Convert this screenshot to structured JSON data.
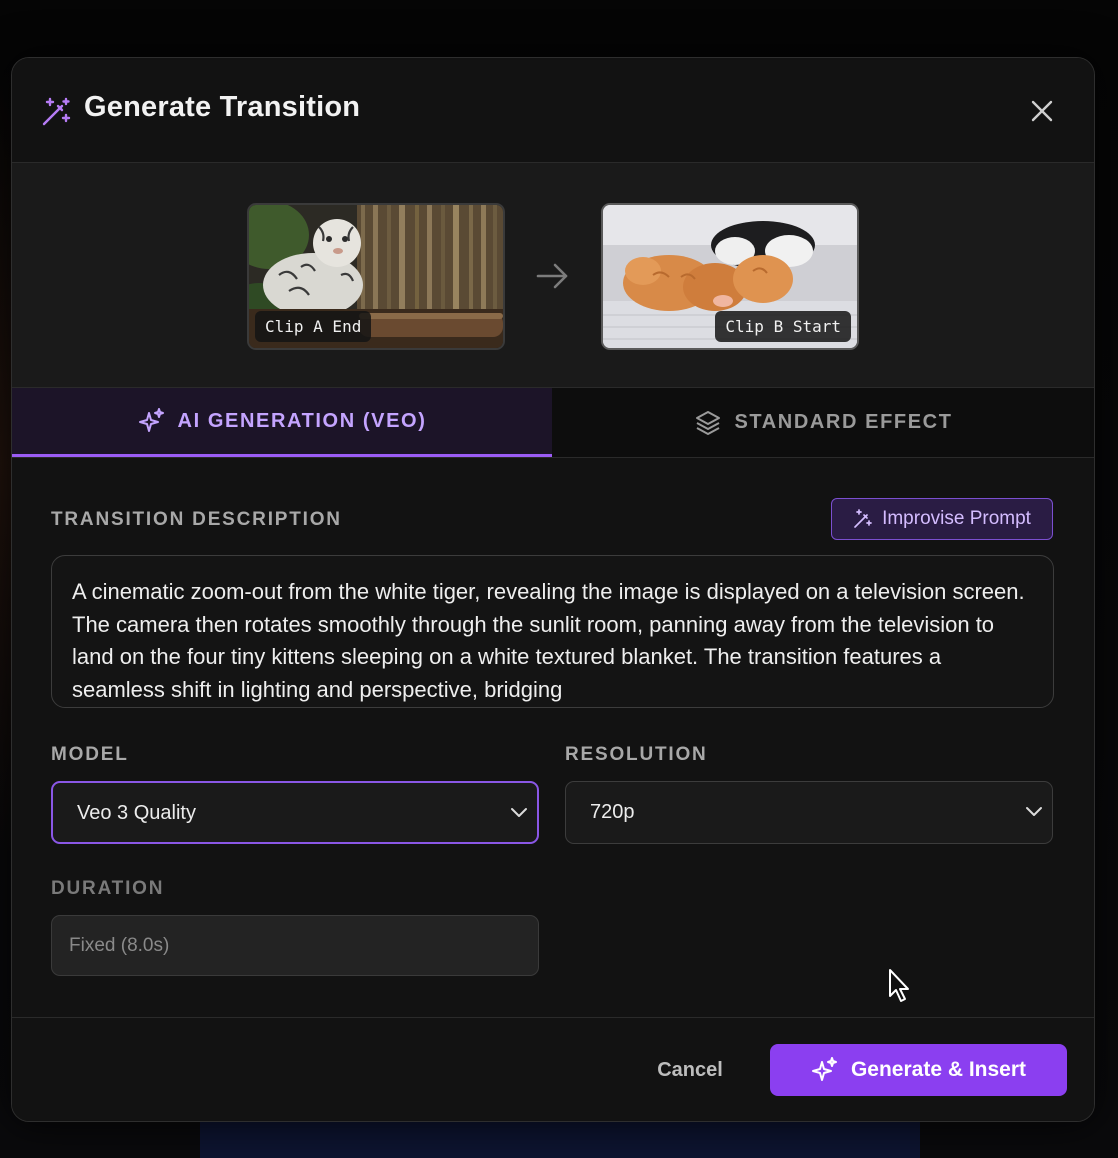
{
  "dialog": {
    "title": "Generate Transition",
    "icon": "magic-wand-icon",
    "close_icon": "close-icon"
  },
  "preview": {
    "clip_a_label": "Clip A End",
    "clip_b_label": "Clip B Start",
    "arrow_icon": "arrow-right-icon"
  },
  "tabs": [
    {
      "label": "AI GENERATION (VEO)",
      "icon": "sparkles-icon",
      "active": true
    },
    {
      "label": "STANDARD EFFECT",
      "icon": "layers-icon",
      "active": false
    }
  ],
  "form": {
    "description_label": "TRANSITION DESCRIPTION",
    "improve_prompt_label": "Improvise Prompt",
    "description_value": "A cinematic zoom-out from the white tiger, revealing the image is displayed on a television screen. The camera then rotates smoothly through the sunlit room, panning away from the television to land on the four tiny kittens sleeping on a white textured blanket. The transition features a seamless shift in lighting and perspective, bridging",
    "model_label": "MODEL",
    "model_value": "Veo 3 Quality",
    "resolution_label": "RESOLUTION",
    "resolution_value": "720p",
    "duration_label": "DURATION",
    "duration_value": "Fixed (8.0s)"
  },
  "footer": {
    "cancel_label": "Cancel",
    "generate_label": "Generate & Insert"
  },
  "colors": {
    "accent": "#8b3ff0",
    "accent_light": "#c4a4ff",
    "background": "#121212"
  }
}
